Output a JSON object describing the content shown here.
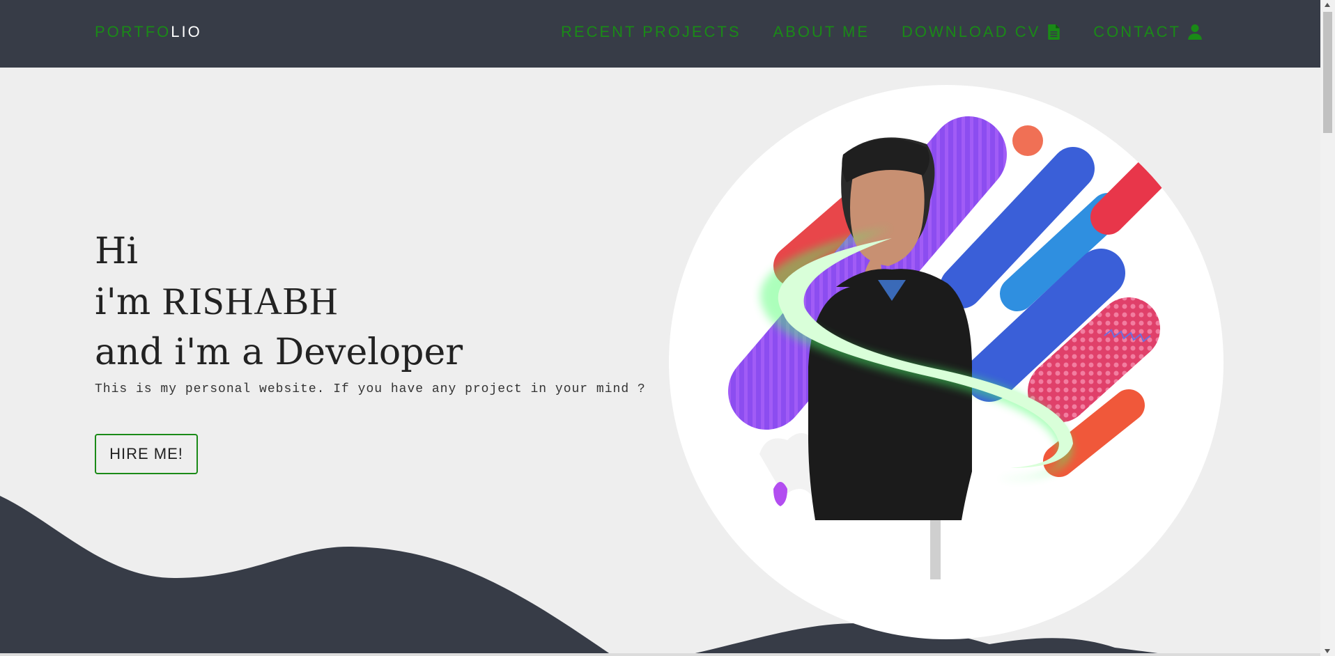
{
  "nav": {
    "brand_part1": "PORTFO",
    "brand_part2": "LIO",
    "links": [
      {
        "label": "RECENT PROJECTS",
        "icon": ""
      },
      {
        "label": "ABOUT ME",
        "icon": ""
      },
      {
        "label": "DOWNLOAD CV",
        "icon": "file-icon"
      },
      {
        "label": "CONTACT",
        "icon": "user-icon"
      }
    ]
  },
  "hero": {
    "line1": "Hi",
    "line2_prefix": "i'm ",
    "name": "RISHABH",
    "line3": "and i'm a Developer",
    "intro": "This is my personal website. If you have any project in your mind ?",
    "cta": "HIRE ME!"
  },
  "colors": {
    "accent": "#1a8a17",
    "navbar": "#373c47",
    "background": "#eeeeee"
  }
}
